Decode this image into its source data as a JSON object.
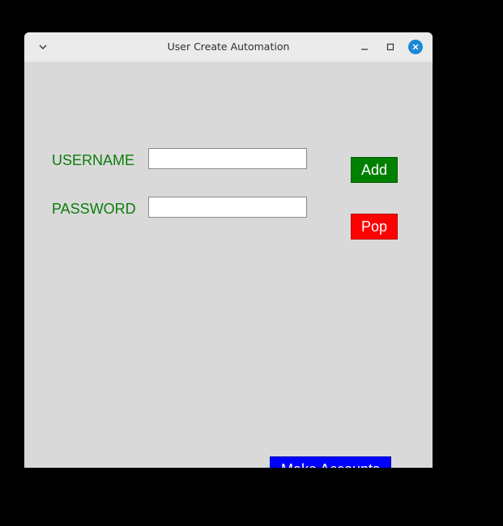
{
  "window": {
    "title": "User Create Automation",
    "icons": {
      "menu": "chevron-down-icon",
      "minimize": "minimize-icon",
      "maximize": "maximize-icon",
      "close": "close-icon"
    },
    "close_color": "#1e88d6",
    "background": "#d9d9d9"
  },
  "form": {
    "username_label": "USERNAME",
    "password_label": "PASSWORD",
    "username_value": "",
    "password_value": "",
    "label_color": "#0d7d0d"
  },
  "buttons": {
    "add": {
      "label": "Add",
      "color": "#008000"
    },
    "pop": {
      "label": "Pop",
      "color": "#ff0000"
    },
    "make_accounts": {
      "label": "Make Accounts",
      "color": "#0000ff"
    }
  }
}
